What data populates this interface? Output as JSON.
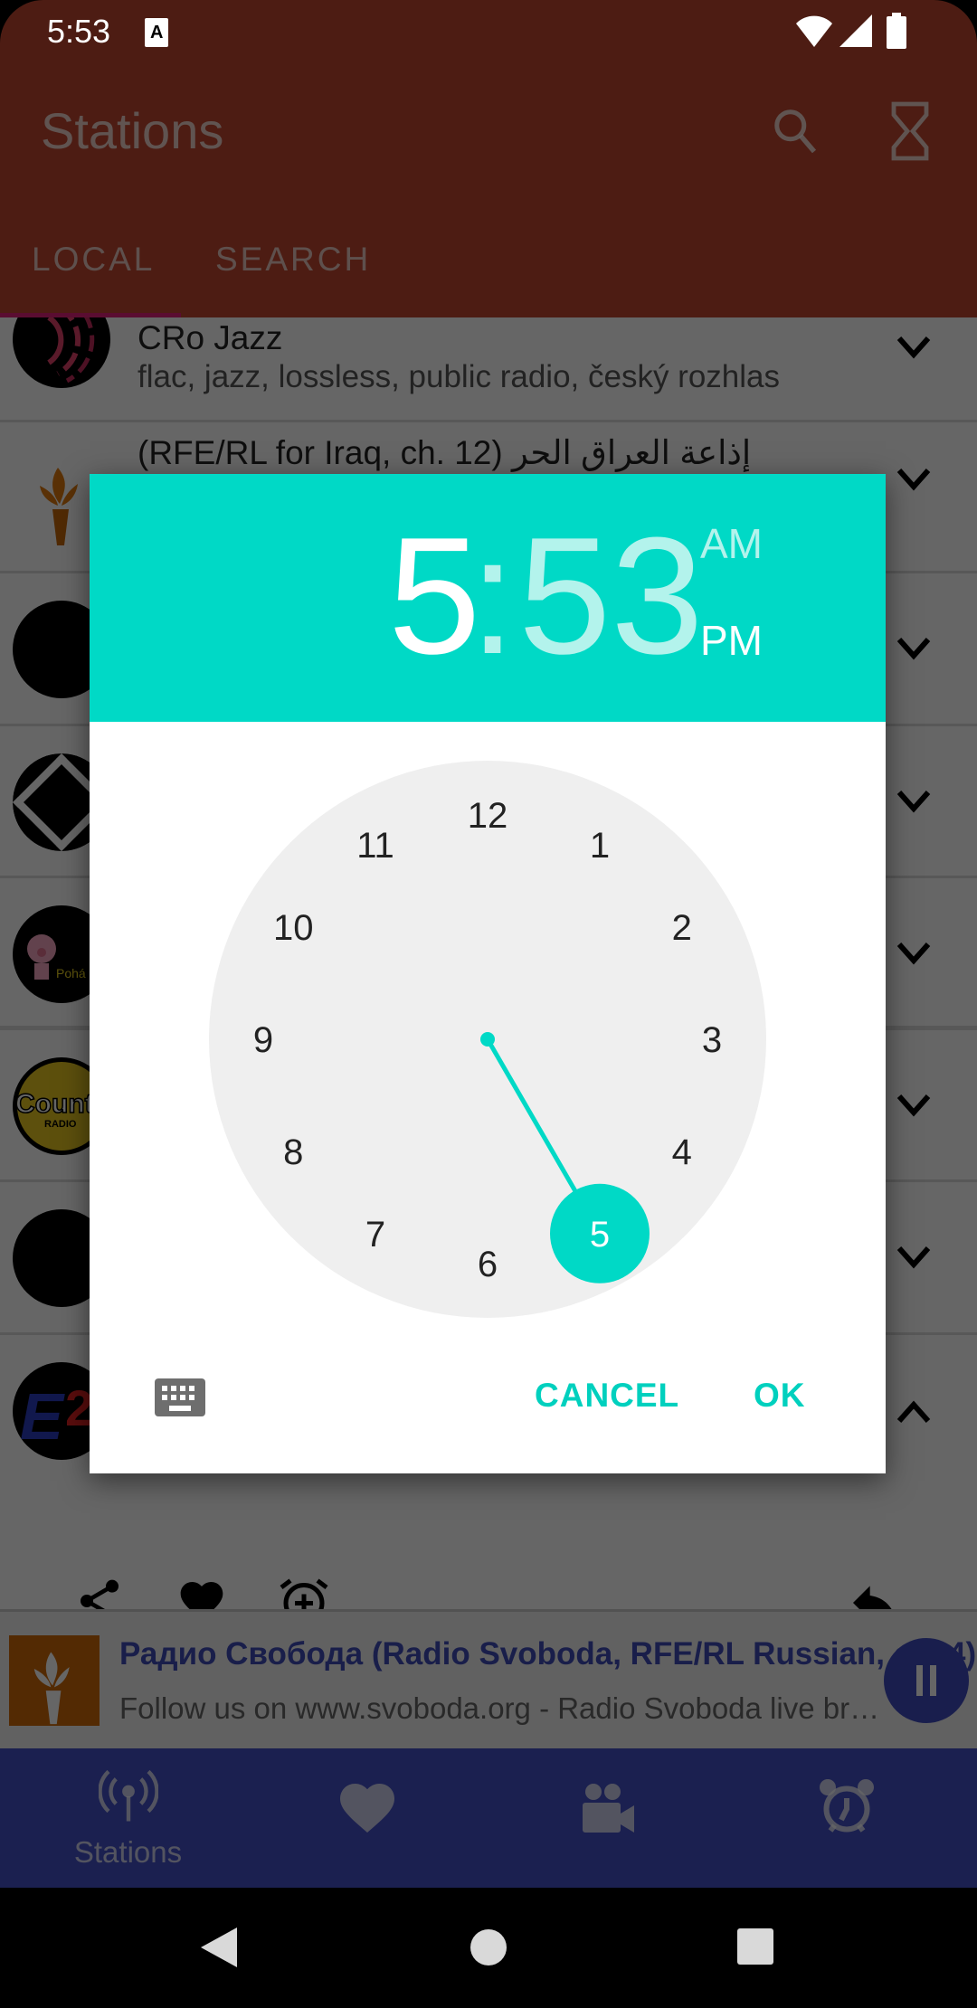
{
  "status_bar": {
    "time": "5:53",
    "icons": [
      "text-a-notification-icon",
      "wifi-icon",
      "cell-signal-icon",
      "battery-icon"
    ]
  },
  "app_bar": {
    "title": "Stations",
    "actions": [
      "search-icon",
      "hourglass-timer-icon"
    ]
  },
  "tabs": [
    {
      "label": "LOCAL",
      "selected": true
    },
    {
      "label": "SEARCH",
      "selected": false
    }
  ],
  "stations": [
    {
      "title": "CRo Jazz",
      "subtitle": "flac, jazz, lossless, public radio, český rozhlas",
      "expanded": false
    },
    {
      "title": "(RFE/RL for Iraq, ch. 12) إذاعة العراق الحر",
      "subtitle": "",
      "expanded": false
    },
    {
      "title": "",
      "subtitle": "",
      "expanded": false
    },
    {
      "title": "",
      "subtitle": "",
      "expanded": false
    },
    {
      "title": "",
      "subtitle": "",
      "logo_text": "Pohá",
      "expanded": false
    },
    {
      "title": "",
      "subtitle": "",
      "logo_text": "Country RADIO",
      "expanded": false
    },
    {
      "title": "",
      "subtitle": "",
      "expanded": false
    },
    {
      "title": "",
      "subtitle": "",
      "logo_text": "E2",
      "expanded": true
    }
  ],
  "row_actions": [
    "share-icon",
    "favorite-heart-icon",
    "alarm-add-icon",
    "reply-back-icon"
  ],
  "now_playing": {
    "title": "Радио Свобода (Radio Svoboda, RFE/RL Russian, ch. 4)",
    "subtitle": "Follow us on www.svoboda.org - Radio Svoboda live bro...",
    "state": "playing"
  },
  "bottom_nav": [
    {
      "label": "Stations",
      "icon": "radio-tower-icon",
      "selected": true
    },
    {
      "label": "",
      "icon": "heart-icon"
    },
    {
      "label": "",
      "icon": "video-camera-icon"
    },
    {
      "label": "",
      "icon": "alarm-clock-icon"
    }
  ],
  "time_picker": {
    "hour": "5",
    "separator": ":",
    "minute": "53",
    "am_label": "AM",
    "pm_label": "PM",
    "selected_period": "PM",
    "dial_numbers": [
      "12",
      "1",
      "2",
      "3",
      "4",
      "5",
      "6",
      "7",
      "8",
      "9",
      "10",
      "11"
    ],
    "selected_hour": "5",
    "cancel_label": "CANCEL",
    "ok_label": "OK",
    "accent_color": "#00d9c6"
  }
}
